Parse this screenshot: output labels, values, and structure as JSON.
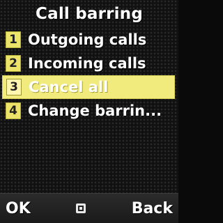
{
  "header": {
    "title": "Call barring"
  },
  "menu": {
    "items": [
      {
        "number": "1",
        "label": "Outgoing calls",
        "selected": false
      },
      {
        "number": "2",
        "label": "Incoming calls",
        "selected": false
      },
      {
        "number": "3",
        "label": "Cancel all",
        "selected": true
      },
      {
        "number": "4",
        "label": "Change barrin...",
        "selected": false
      }
    ]
  },
  "softkeys": {
    "left": "OK",
    "center_icon": "select-square-icon",
    "right": "Back"
  },
  "colors": {
    "selection_bg": "#f1ea7c",
    "number_badge": "#ece36a",
    "text": "#ffffff",
    "background": "#111111"
  }
}
